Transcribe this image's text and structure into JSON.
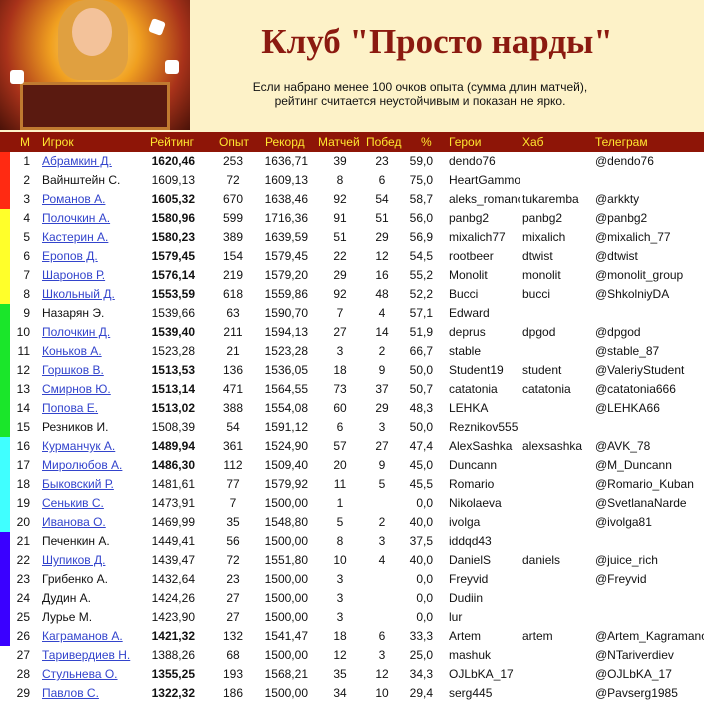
{
  "header": {
    "title": "Клуб \"Просто нарды\"",
    "note_line1": "Если набрано менее 100 очков опыта (сумма длин матчей),",
    "note_line2": "рейтинг считается неустойчивым и показан не ярко."
  },
  "columns": {
    "place": "М",
    "player": "Игрок",
    "rating": "Рейтинг",
    "exp": "Опыт",
    "record": "Рекорд",
    "matches": "Матчей",
    "wins": "Побед",
    "pct": "%",
    "heroes": "Герои",
    "hub": "Хаб",
    "telegram": "Телеграм"
  },
  "colors": {
    "header_bg": "#8e1507",
    "header_text": "#ffe630",
    "title": "#8b1a10",
    "link": "#3344cc",
    "tiers": {
      "red": "#ff2a12",
      "yellow": "#ffff2a",
      "green": "#1ae62a",
      "cyan": "#40ffff",
      "violet": "#3a00ff"
    }
  },
  "rows": [
    {
      "n": "1",
      "name": "Абрамкин Д.",
      "link": true,
      "rating": "1620,46",
      "bold": true,
      "exp": "253",
      "record": "1636,71",
      "m": "39",
      "w": "23",
      "p": "59,0",
      "hero": "dendo76",
      "hub": "",
      "tg": "@dendo76",
      "tier": "red"
    },
    {
      "n": "2",
      "name": "Вайнштейн С.",
      "link": false,
      "rating": "1609,13",
      "bold": false,
      "exp": "72",
      "record": "1609,13",
      "m": "8",
      "w": "6",
      "p": "75,0",
      "hero": "HeartGammon",
      "hub": "",
      "tg": "",
      "tier": "red"
    },
    {
      "n": "3",
      "name": "Романов А.",
      "link": true,
      "rating": "1605,32",
      "bold": true,
      "exp": "670",
      "record": "1638,46",
      "m": "92",
      "w": "54",
      "p": "58,7",
      "hero": "aleks_romanov",
      "hub": "tukaremba",
      "tg": "@arkkty",
      "tier": "red"
    },
    {
      "n": "4",
      "name": "Полочкин А.",
      "link": true,
      "rating": "1580,96",
      "bold": true,
      "exp": "599",
      "record": "1716,36",
      "m": "91",
      "w": "51",
      "p": "56,0",
      "hero": "panbg2",
      "hub": "panbg2",
      "tg": "@panbg2",
      "tier": "yellow"
    },
    {
      "n": "5",
      "name": "Кастерин А.",
      "link": true,
      "rating": "1580,23",
      "bold": true,
      "exp": "389",
      "record": "1639,59",
      "m": "51",
      "w": "29",
      "p": "56,9",
      "hero": "mixalich77",
      "hub": "mixalich",
      "tg": "@mixalich_77",
      "tier": "yellow"
    },
    {
      "n": "6",
      "name": "Еропов Д.",
      "link": true,
      "rating": "1579,45",
      "bold": true,
      "exp": "154",
      "record": "1579,45",
      "m": "22",
      "w": "12",
      "p": "54,5",
      "hero": "rootbeer",
      "hub": "dtwist",
      "tg": "@dtwist",
      "tier": "yellow"
    },
    {
      "n": "7",
      "name": "Шаронов Р.",
      "link": true,
      "rating": "1576,14",
      "bold": true,
      "exp": "219",
      "record": "1579,20",
      "m": "29",
      "w": "16",
      "p": "55,2",
      "hero": "Monolit",
      "hub": "monolit",
      "tg": "@monolit_group",
      "tier": "yellow"
    },
    {
      "n": "8",
      "name": "Школьный Д.",
      "link": true,
      "rating": "1553,59",
      "bold": true,
      "exp": "618",
      "record": "1559,86",
      "m": "92",
      "w": "48",
      "p": "52,2",
      "hero": "Bucci",
      "hub": "bucci",
      "tg": "@ShkolniyDA",
      "tier": "yellow"
    },
    {
      "n": "9",
      "name": "Назарян Э.",
      "link": false,
      "rating": "1539,66",
      "bold": false,
      "exp": "63",
      "record": "1590,70",
      "m": "7",
      "w": "4",
      "p": "57,1",
      "hero": "Edward",
      "hub": "",
      "tg": "",
      "tier": "green"
    },
    {
      "n": "10",
      "name": "Полочкин Д.",
      "link": true,
      "rating": "1539,40",
      "bold": true,
      "exp": "211",
      "record": "1594,13",
      "m": "27",
      "w": "14",
      "p": "51,9",
      "hero": "deprus",
      "hub": "dpgod",
      "tg": "@dpgod",
      "tier": "green"
    },
    {
      "n": "11",
      "name": "Коньков А.",
      "link": true,
      "rating": "1523,28",
      "bold": false,
      "exp": "21",
      "record": "1523,28",
      "m": "3",
      "w": "2",
      "p": "66,7",
      "hero": "stable",
      "hub": "",
      "tg": "@stable_87",
      "tier": "green"
    },
    {
      "n": "12",
      "name": "Горшков В.",
      "link": true,
      "rating": "1513,53",
      "bold": true,
      "exp": "136",
      "record": "1536,05",
      "m": "18",
      "w": "9",
      "p": "50,0",
      "hero": "Student19",
      "hub": "student",
      "tg": "@ValeriyStudent",
      "tier": "green"
    },
    {
      "n": "13",
      "name": "Смирнов Ю.",
      "link": true,
      "rating": "1513,14",
      "bold": true,
      "exp": "471",
      "record": "1564,55",
      "m": "73",
      "w": "37",
      "p": "50,7",
      "hero": "catatonia",
      "hub": "catatonia",
      "tg": "@catatonia666",
      "tier": "green"
    },
    {
      "n": "14",
      "name": "Попова Е.",
      "link": true,
      "rating": "1513,02",
      "bold": true,
      "exp": "388",
      "record": "1554,08",
      "m": "60",
      "w": "29",
      "p": "48,3",
      "hero": "LEHKA",
      "hub": "",
      "tg": "@LEHKA66",
      "tier": "green"
    },
    {
      "n": "15",
      "name": "Резников И.",
      "link": false,
      "rating": "1508,39",
      "bold": false,
      "exp": "54",
      "record": "1591,12",
      "m": "6",
      "w": "3",
      "p": "50,0",
      "hero": "Reznikov555",
      "hub": "",
      "tg": "",
      "tier": "green"
    },
    {
      "n": "16",
      "name": "Курманчук А.",
      "link": true,
      "rating": "1489,94",
      "bold": true,
      "exp": "361",
      "record": "1524,90",
      "m": "57",
      "w": "27",
      "p": "47,4",
      "hero": "AlexSashka",
      "hub": "alexsashka",
      "tg": "@AVK_78",
      "tier": "cyan"
    },
    {
      "n": "17",
      "name": "Миролюбов А.",
      "link": true,
      "rating": "1486,30",
      "bold": true,
      "exp": "112",
      "record": "1509,40",
      "m": "20",
      "w": "9",
      "p": "45,0",
      "hero": "Duncann",
      "hub": "",
      "tg": "@M_Duncann",
      "tier": "cyan"
    },
    {
      "n": "18",
      "name": "Быковский Р.",
      "link": true,
      "rating": "1481,61",
      "bold": false,
      "exp": "77",
      "record": "1579,92",
      "m": "11",
      "w": "5",
      "p": "45,5",
      "hero": "Romario",
      "hub": "",
      "tg": "@Romario_Kuban",
      "tier": "cyan"
    },
    {
      "n": "19",
      "name": "Сенькив С.",
      "link": true,
      "rating": "1473,91",
      "bold": false,
      "exp": "7",
      "record": "1500,00",
      "m": "1",
      "w": "",
      "p": "0,0",
      "hero": "Nikolaeva",
      "hub": "",
      "tg": "@SvetlanaNarde",
      "tier": "cyan"
    },
    {
      "n": "20",
      "name": "Иванова О.",
      "link": true,
      "rating": "1469,99",
      "bold": false,
      "exp": "35",
      "record": "1548,80",
      "m": "5",
      "w": "2",
      "p": "40,0",
      "hero": "ivolga",
      "hub": "",
      "tg": "@ivolga81",
      "tier": "cyan"
    },
    {
      "n": "21",
      "name": "Печенкин А.",
      "link": false,
      "rating": "1449,41",
      "bold": false,
      "exp": "56",
      "record": "1500,00",
      "m": "8",
      "w": "3",
      "p": "37,5",
      "hero": "iddqd43",
      "hub": "",
      "tg": "",
      "tier": "violet"
    },
    {
      "n": "22",
      "name": "Шупиков Д.",
      "link": true,
      "rating": "1439,47",
      "bold": false,
      "exp": "72",
      "record": "1551,80",
      "m": "10",
      "w": "4",
      "p": "40,0",
      "hero": "DanielS",
      "hub": "daniels",
      "tg": "@juice_rich",
      "tier": "violet"
    },
    {
      "n": "23",
      "name": "Грибенко А.",
      "link": false,
      "rating": "1432,64",
      "bold": false,
      "exp": "23",
      "record": "1500,00",
      "m": "3",
      "w": "",
      "p": "0,0",
      "hero": "Freyvid",
      "hub": "",
      "tg": "@Freyvid",
      "tier": "violet"
    },
    {
      "n": "24",
      "name": "Дудин А.",
      "link": false,
      "rating": "1424,26",
      "bold": false,
      "exp": "27",
      "record": "1500,00",
      "m": "3",
      "w": "",
      "p": "0,0",
      "hero": "Dudiin",
      "hub": "",
      "tg": "",
      "tier": "violet"
    },
    {
      "n": "25",
      "name": "Лурье М.",
      "link": false,
      "rating": "1423,90",
      "bold": false,
      "exp": "27",
      "record": "1500,00",
      "m": "3",
      "w": "",
      "p": "0,0",
      "hero": "lur",
      "hub": "",
      "tg": "",
      "tier": "violet"
    },
    {
      "n": "26",
      "name": "Каграманов А.",
      "link": true,
      "rating": "1421,32",
      "bold": true,
      "exp": "132",
      "record": "1541,47",
      "m": "18",
      "w": "6",
      "p": "33,3",
      "hero": "Artem",
      "hub": "artem",
      "tg": "@Artem_Kagramanov",
      "tier": "violet"
    },
    {
      "n": "27",
      "name": "Таривердиев Н.",
      "link": true,
      "rating": "1388,26",
      "bold": false,
      "exp": "68",
      "record": "1500,00",
      "m": "12",
      "w": "3",
      "p": "25,0",
      "hero": "mashuk",
      "hub": "",
      "tg": "@NTariverdiev",
      "tier": ""
    },
    {
      "n": "28",
      "name": "Стульнева О.",
      "link": true,
      "rating": "1355,25",
      "bold": true,
      "exp": "193",
      "record": "1568,21",
      "m": "35",
      "w": "12",
      "p": "34,3",
      "hero": "OJLbKA_17",
      "hub": "",
      "tg": "@OJLbKA_17",
      "tier": ""
    },
    {
      "n": "29",
      "name": "Павлов С.",
      "link": true,
      "rating": "1322,32",
      "bold": true,
      "exp": "186",
      "record": "1500,00",
      "m": "34",
      "w": "10",
      "p": "29,4",
      "hero": "serg445",
      "hub": "",
      "tg": "@Pavserg1985",
      "tier": ""
    }
  ]
}
